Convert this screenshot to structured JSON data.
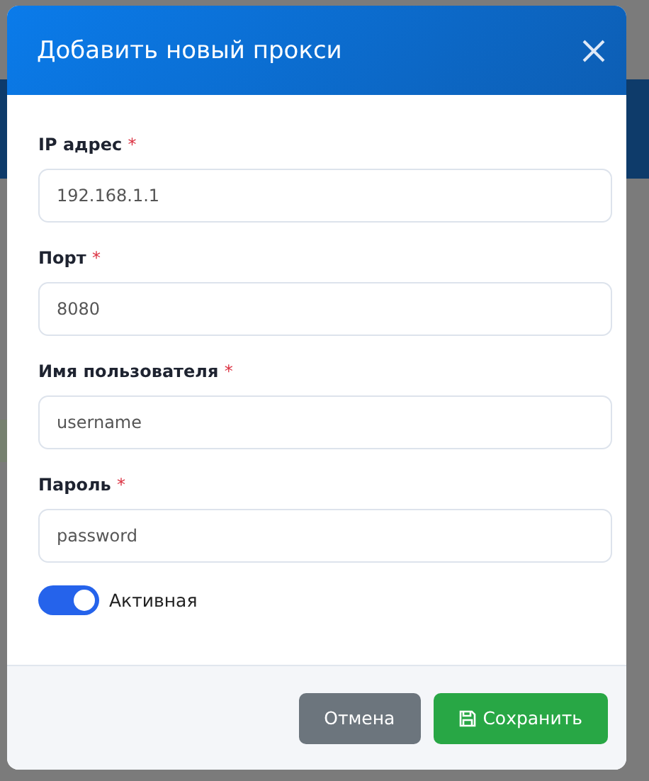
{
  "dialog": {
    "title": "Добавить новый прокси",
    "fields": [
      {
        "label": "IP адрес",
        "required_mark": "*",
        "placeholder": "192.168.1.1"
      },
      {
        "label": "Порт",
        "required_mark": "*",
        "placeholder": "8080"
      },
      {
        "label": "Имя пользователя",
        "required_mark": "*",
        "placeholder": "username"
      },
      {
        "label": "Пароль",
        "required_mark": "*",
        "placeholder": "password"
      }
    ],
    "toggle": {
      "label": "Активная",
      "on": true
    },
    "buttons": [
      {
        "kind": "cancel",
        "label": "Отмена"
      },
      {
        "kind": "save",
        "label": "Сохранить"
      }
    ]
  }
}
